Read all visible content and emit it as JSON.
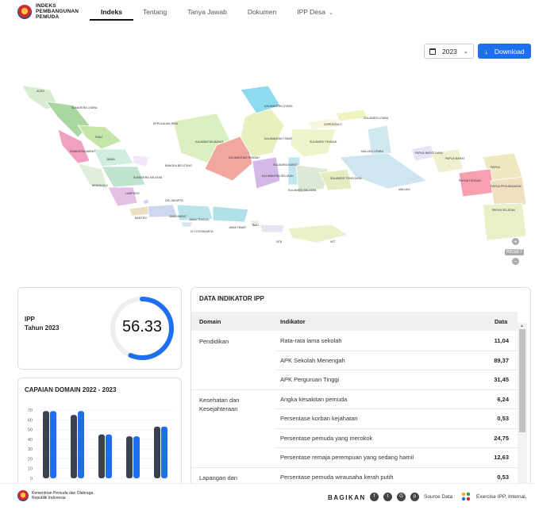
{
  "header": {
    "logo_line1": "INDEKS",
    "logo_line2": "PEMBANGUNAN",
    "logo_line3": "PEMUDA",
    "nav": [
      {
        "label": "Indeks",
        "active": true
      },
      {
        "label": "Tentang",
        "active": false
      },
      {
        "label": "Tanya Jawab",
        "active": false
      },
      {
        "label": "Dokumen",
        "active": false
      },
      {
        "label": "IPP Desa",
        "active": false
      }
    ]
  },
  "controls": {
    "year_selected": "2023",
    "download_label": "Download"
  },
  "map": {
    "reset_label": "RESET",
    "zoom_in": "+",
    "zoom_out": "−",
    "regions": [
      {
        "label": "ACEH",
        "color": "#d9ecd2"
      },
      {
        "label": "SUMATERA UTARA",
        "color": "#a8d8a0"
      },
      {
        "label": "RIAU",
        "color": "#c6e6a9"
      },
      {
        "label": "KEPULAUAN RIAU",
        "color": "#ffffff"
      },
      {
        "label": "SUMATERA BARAT",
        "color": "#f0a0c0"
      },
      {
        "label": "JAMBI",
        "color": "#d0eedd"
      },
      {
        "label": "BANGKA BELITUNG",
        "color": "#f0e6f5"
      },
      {
        "label": "SUMATERA SELATAN",
        "color": "#bfe3cf"
      },
      {
        "label": "BENGKULU",
        "color": "#e0eeda"
      },
      {
        "label": "LAMPUNG",
        "color": "#e5c0e6"
      },
      {
        "label": "DKI JAKARTA",
        "color": "#d5d5f0"
      },
      {
        "label": "BANTEN",
        "color": "#e8e0c0"
      },
      {
        "label": "JAWA BARAT",
        "color": "#cfd7f0"
      },
      {
        "label": "JAWA TENGAH",
        "color": "#b9e3e8"
      },
      {
        "label": "DI YOGYAKARTA",
        "color": "#d6e6f0"
      },
      {
        "label": "JAWA TIMUR",
        "color": "#b0e0e8"
      },
      {
        "label": "BALI",
        "color": "#e0eedd"
      },
      {
        "label": "NTB",
        "color": "#e6e6f2"
      },
      {
        "label": "NTT",
        "color": "#eaf0c8"
      },
      {
        "label": "KALIMANTAN BARAT",
        "color": "#dbf0c0"
      },
      {
        "label": "KALIMANTAN TENGAH",
        "color": "#f1a7a0"
      },
      {
        "label": "KALIMANTAN SELATAN",
        "color": "#d4b8e8"
      },
      {
        "label": "KALIMANTAN TIMUR",
        "color": "#e8f0c0"
      },
      {
        "label": "KALIMANTAN UTARA",
        "color": "#8edaee"
      },
      {
        "label": "SULAWESI UTARA",
        "color": "#f0f5c0"
      },
      {
        "label": "GORONTALO",
        "color": "#f6f7da"
      },
      {
        "label": "SULAWESI TENGAH",
        "color": "#eef4c9"
      },
      {
        "label": "SULAWESI BARAT",
        "color": "#c2e6f0"
      },
      {
        "label": "SULAWESI SELATAN",
        "color": "#dde8d5"
      },
      {
        "label": "SULAWESI TENGGARA",
        "color": "#e6ecc0"
      },
      {
        "label": "MALUKU UTARA",
        "color": "#d0e8f0"
      },
      {
        "label": "MALUKU",
        "color": "#cfe6f0"
      },
      {
        "label": "PAPUA BARAT DAYA",
        "color": "#e6e6f8"
      },
      {
        "label": "PAPUA BARAT",
        "color": "#f0f0d0"
      },
      {
        "label": "PAPUA",
        "color": "#f0e8c0"
      },
      {
        "label": "PAPUA TENGAH",
        "color": "#f6a0b0"
      },
      {
        "label": "PAPUA PEGUNUNGAN",
        "color": "#f0e0c0"
      },
      {
        "label": "PAPUA SELATAN",
        "color": "#e8f0c8"
      }
    ]
  },
  "ipp": {
    "label": "IPP",
    "year_label": "Tahun 2023",
    "value": "56.33",
    "fraction": 0.5633,
    "color": "#1e6ff0"
  },
  "capaian": {
    "title": "CAPAIAN DOMAIN 2022 - 2023",
    "chart_data": {
      "type": "bar",
      "ylim": [
        0,
        70
      ],
      "yticks": [
        "0",
        "10",
        "20",
        "30",
        "40",
        "50",
        "60",
        "70"
      ],
      "series": [
        {
          "name": "",
          "color": "#3a4252",
          "values": [
            69,
            65,
            45,
            43,
            53
          ]
        },
        {
          "name": "",
          "color": "#1e6ff0",
          "values": [
            69,
            69,
            45,
            43,
            53
          ]
        }
      ]
    }
  },
  "table": {
    "title": "DATA INDIKATOR IPP",
    "headers": {
      "domain": "Domain",
      "indikator": "Indikator",
      "data": "Data"
    },
    "groups": [
      {
        "domain": "Pendidikan",
        "rows": [
          {
            "indikator": "Rata-rata lama sekolah",
            "data": "11,04"
          },
          {
            "indikator": "APK Sekolah Menengah",
            "data": "89,37"
          },
          {
            "indikator": "APK Perguruan Tinggi",
            "data": "31,45"
          }
        ]
      },
      {
        "domain": "Kesehatan dan Kesejahteraan",
        "rows": [
          {
            "indikator": "Angka kesakitan pemuda",
            "data": "6,24"
          },
          {
            "indikator": "Persentase korban kejahatan",
            "data": "0,53"
          },
          {
            "indikator": "Persentase pemuda yang merokok",
            "data": "24,75"
          },
          {
            "indikator": "Persentase remaja perempuan yang sedang hamil",
            "data": "12,63"
          }
        ]
      },
      {
        "domain": "Lapangan dan Kesempatan Kerja",
        "rows": [
          {
            "indikator": "Persentase pemuda wirausaha kerah putih",
            "data": "0,53"
          }
        ]
      }
    ]
  },
  "footer": {
    "org_line1": "Kementrian Pemuda dan Olahraga",
    "org_line2": "Republik Indonesia",
    "share_label": "BAGIKAN",
    "social": [
      {
        "icon": "facebook-icon",
        "glyph": "f"
      },
      {
        "icon": "twitter-icon",
        "glyph": "t"
      },
      {
        "icon": "google-plus-icon",
        "glyph": "G"
      },
      {
        "icon": "pinterest-icon",
        "glyph": "p"
      }
    ],
    "source_label": "Source Data :",
    "source_value": "Exercise IPP, Internal,"
  }
}
